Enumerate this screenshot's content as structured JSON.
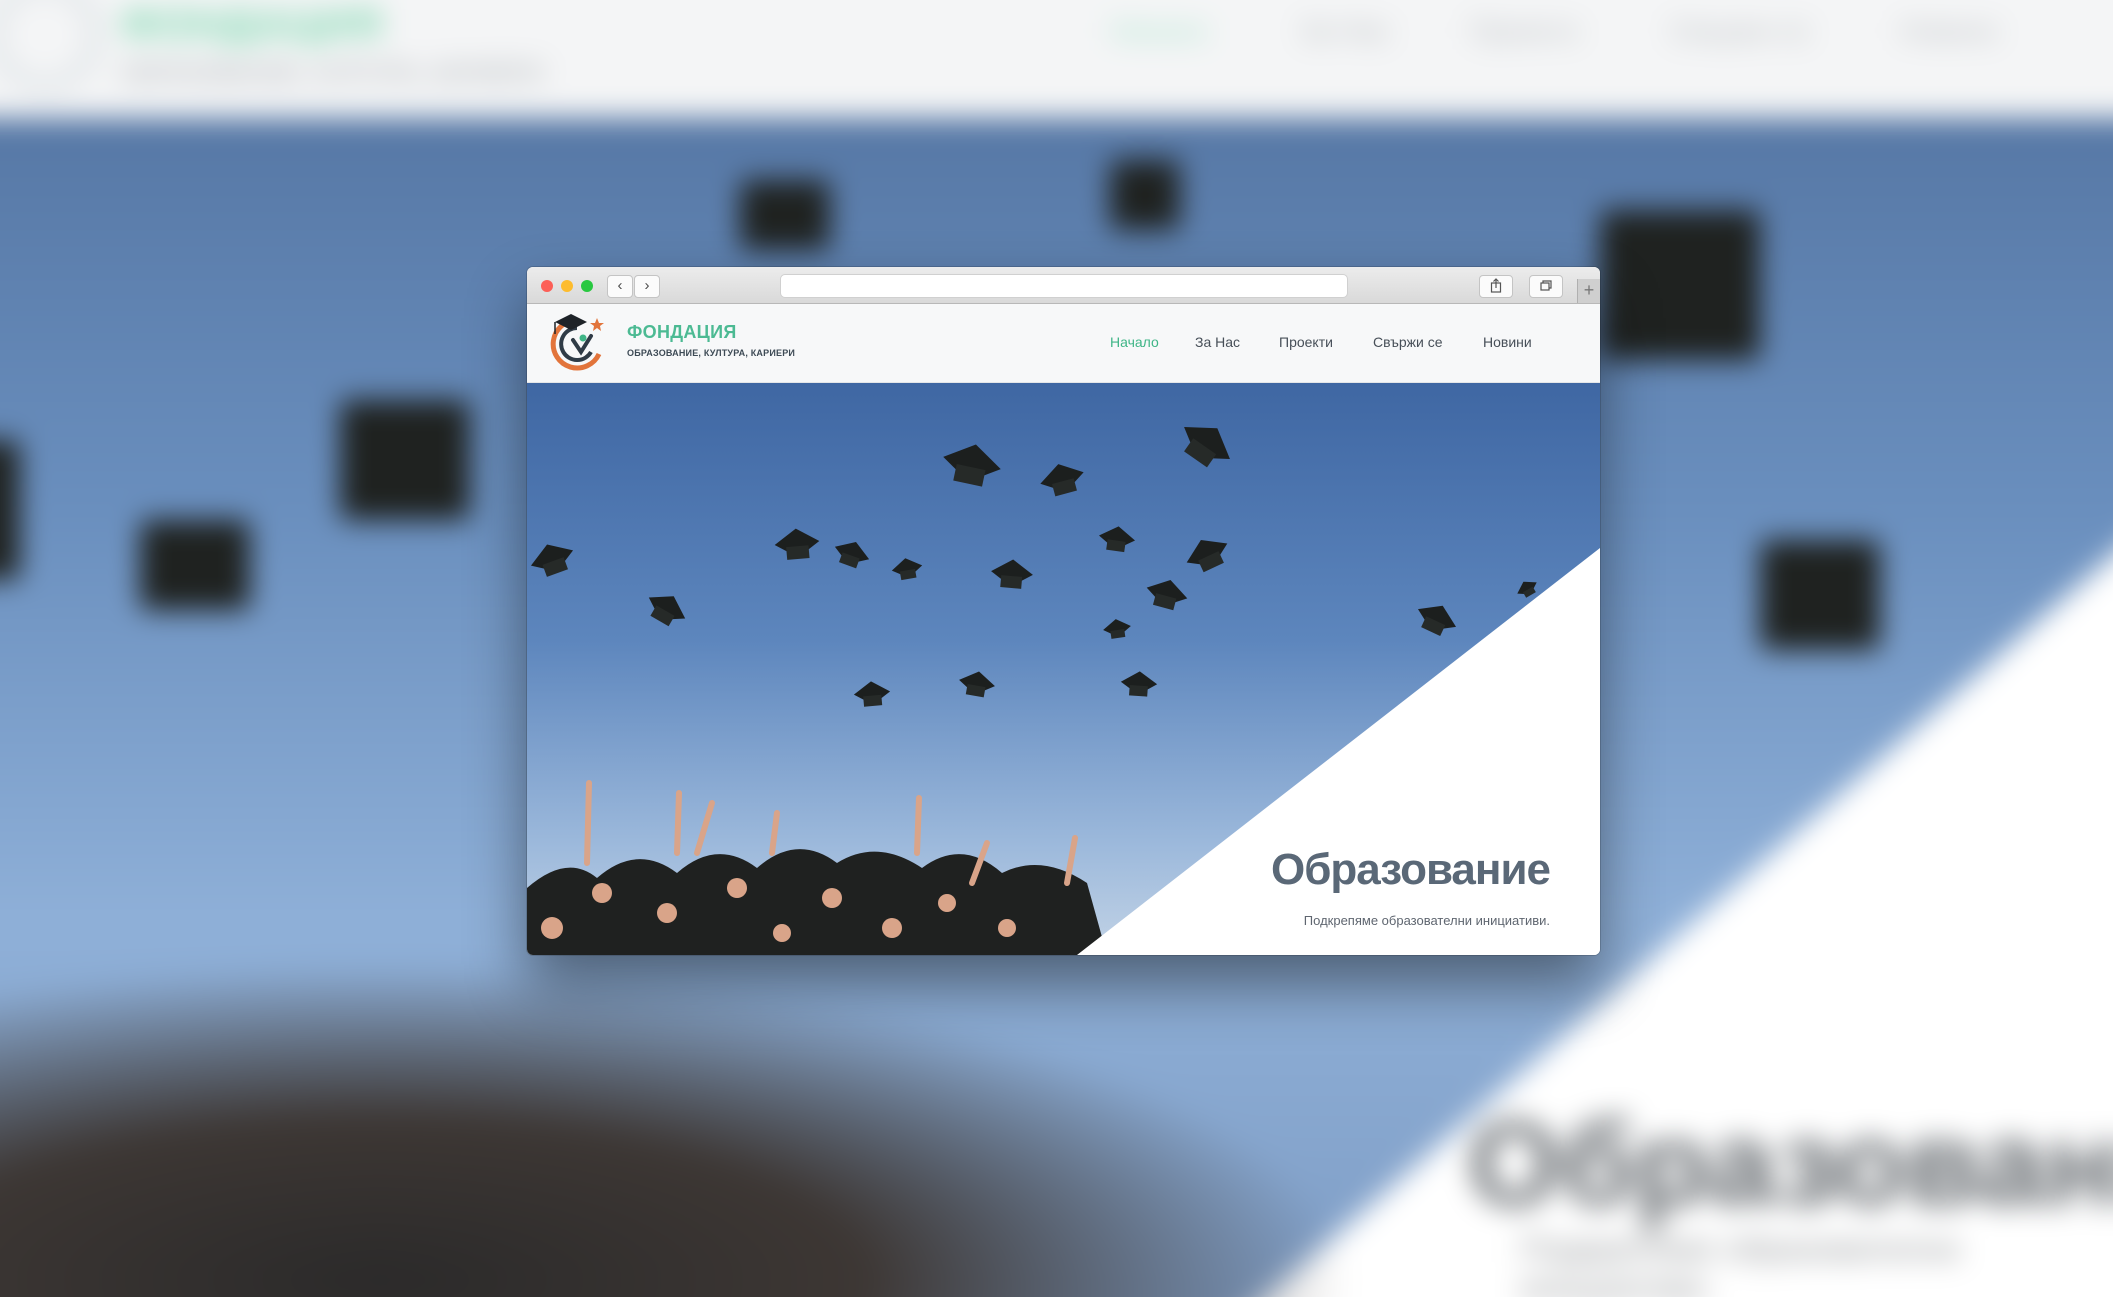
{
  "site": {
    "brand": "ФОНДАЦИЯ",
    "tagline": "ОБРАЗОВАНИЕ, КУЛТУРА, КАРИЕРИ"
  },
  "nav": [
    {
      "label": "Начало",
      "active": true
    },
    {
      "label": "За Нас",
      "active": false
    },
    {
      "label": "Проекти",
      "active": false
    },
    {
      "label": "Свържи се",
      "active": false
    },
    {
      "label": "Новини",
      "active": false
    }
  ],
  "browser": {
    "back": "‹",
    "forward": "›",
    "new_tab": "+"
  },
  "hero": {
    "title": "Образование",
    "subtitle": "Подкрепяме образователни инициативи."
  },
  "colors": {
    "accent": "#3fb587",
    "brand": "#4cba93",
    "logo_orange": "#e2743b",
    "title": "#5a6877",
    "sky": "#5d82b8"
  }
}
